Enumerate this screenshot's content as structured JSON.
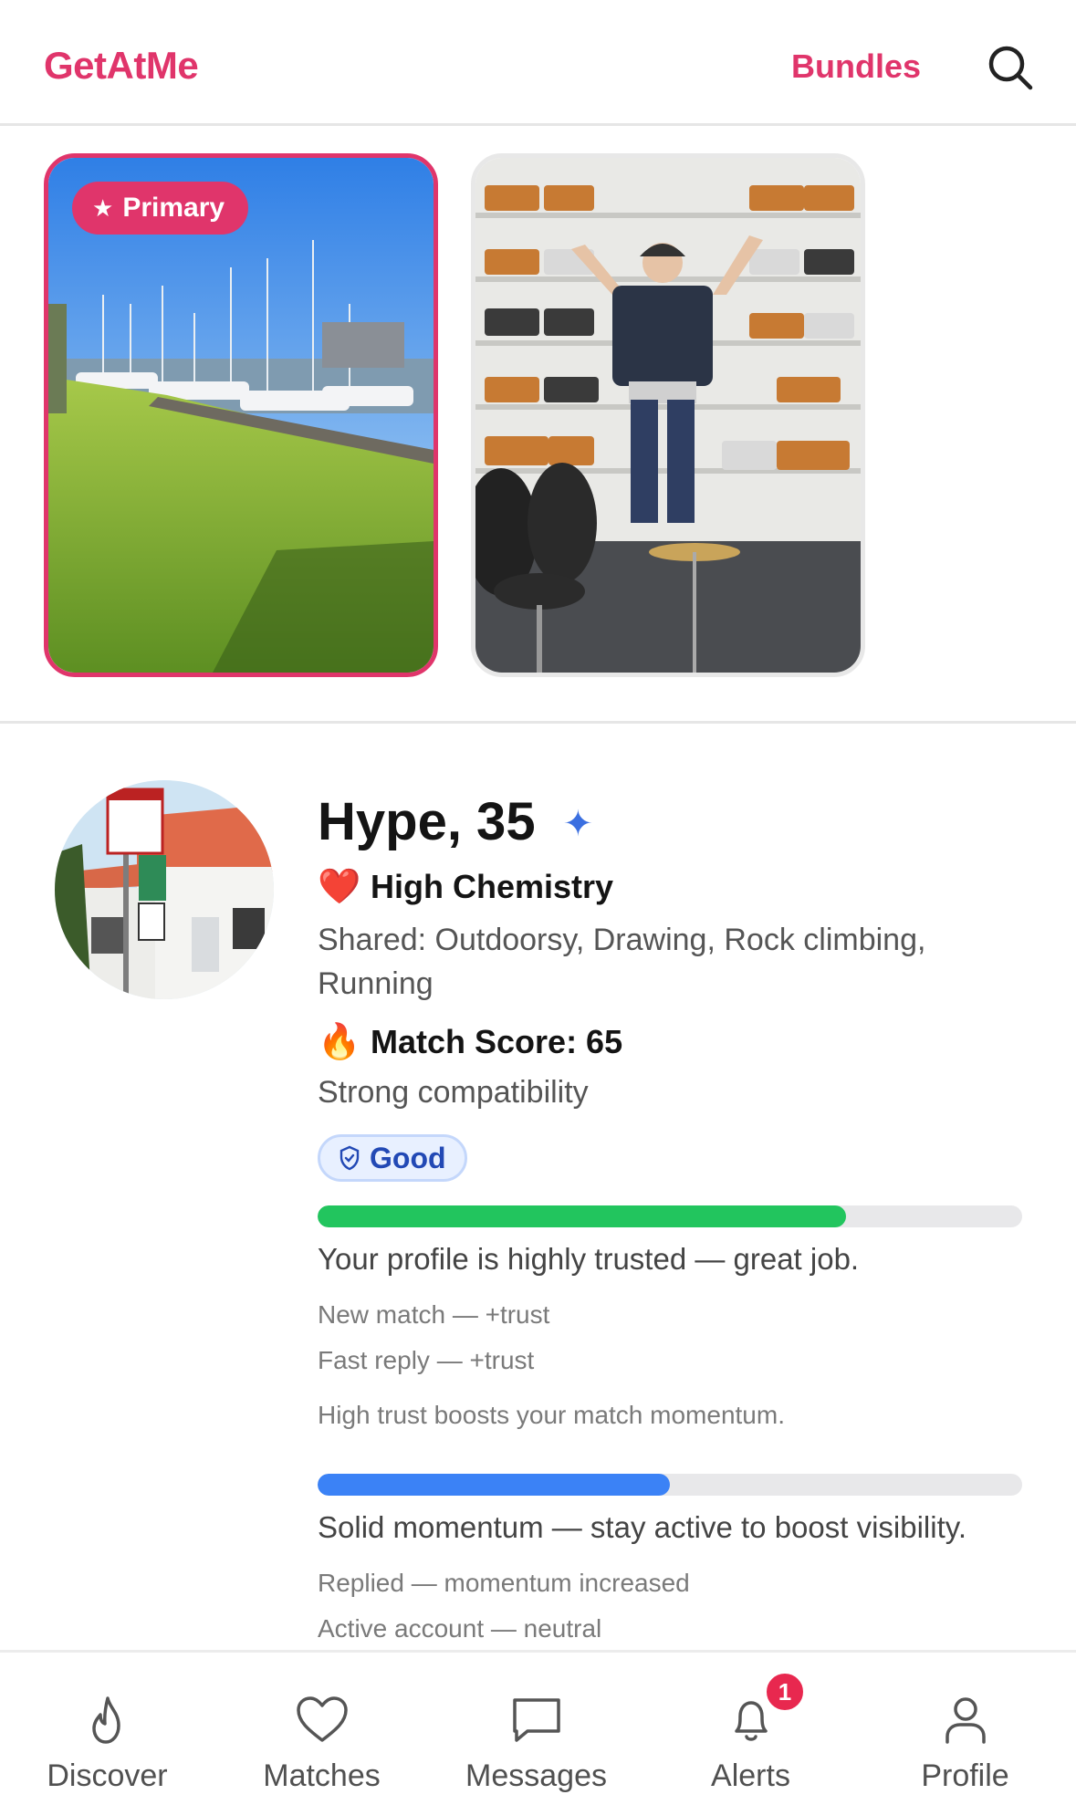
{
  "header": {
    "brand": "GetAtMe",
    "bundles_label": "Bundles",
    "search_icon": "search-icon"
  },
  "photos": {
    "primary_label": "Primary",
    "items": [
      {
        "description_icon": "photo-marina",
        "is_primary": true
      },
      {
        "description_icon": "photo-drum-room",
        "is_primary": false
      }
    ]
  },
  "profile": {
    "name_age": "Hype, 35",
    "verified_icon": "sparkle-icon",
    "chemistry": {
      "emoji": "❤️",
      "title": "High Chemistry",
      "shared": "Shared: Outdoorsy, Drawing, Rock climbing, Running"
    },
    "match": {
      "emoji": "🔥",
      "title": "Match Score: 65",
      "subtitle": "Strong compatibility"
    },
    "trust": {
      "badge": "Good",
      "level_percent": 75,
      "summary": "Your profile is highly trusted — great job.",
      "events": [
        "New match — +trust",
        "Fast reply — +trust"
      ],
      "note": "High trust boosts your match momentum."
    },
    "momentum": {
      "level_percent": 50,
      "summary": "Solid momentum — stay active to boost visibility.",
      "events": [
        "Replied — momentum increased",
        "Active account — neutral"
      ]
    }
  },
  "nav": {
    "items": [
      {
        "label": "Discover",
        "icon": "flame-icon"
      },
      {
        "label": "Matches",
        "icon": "heart-icon"
      },
      {
        "label": "Messages",
        "icon": "message-icon"
      },
      {
        "label": "Alerts",
        "icon": "bell-icon",
        "badge": "1"
      },
      {
        "label": "Profile",
        "icon": "user-icon"
      }
    ]
  },
  "colors": {
    "brand": "#e0356b",
    "trust": "#22c55e",
    "momentum": "#3b82f6"
  }
}
